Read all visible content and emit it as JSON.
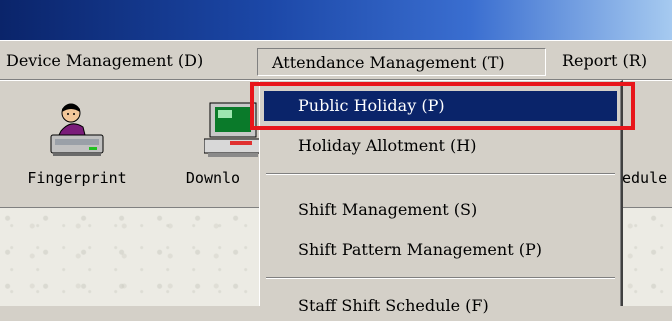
{
  "menubar": {
    "device_management": "Device Management (D)",
    "attendance_management": "Attendance Management (T)",
    "report": "Report (R)"
  },
  "toolbar": {
    "fingerprint_label": "Fingerprint",
    "download_label": "Downlo",
    "schedule_label": "edule"
  },
  "dropdown": {
    "items": [
      {
        "label": "Public Holiday (P)",
        "selected": true
      },
      {
        "label": "Holiday Allotment (H)"
      },
      {
        "label": "Shift Management (S)"
      },
      {
        "label": "Shift Pattern Management (P)"
      },
      {
        "label": "Staff Shift Schedule (F)"
      }
    ]
  },
  "colors": {
    "highlight_border": "#e8161b",
    "selection_bg": "#0a246a",
    "window_face": "#d4d0c8",
    "title_bar": "#0a246a"
  },
  "icons": {
    "fingerprint": "person-on-scanner-icon",
    "download": "computer-download-icon"
  }
}
